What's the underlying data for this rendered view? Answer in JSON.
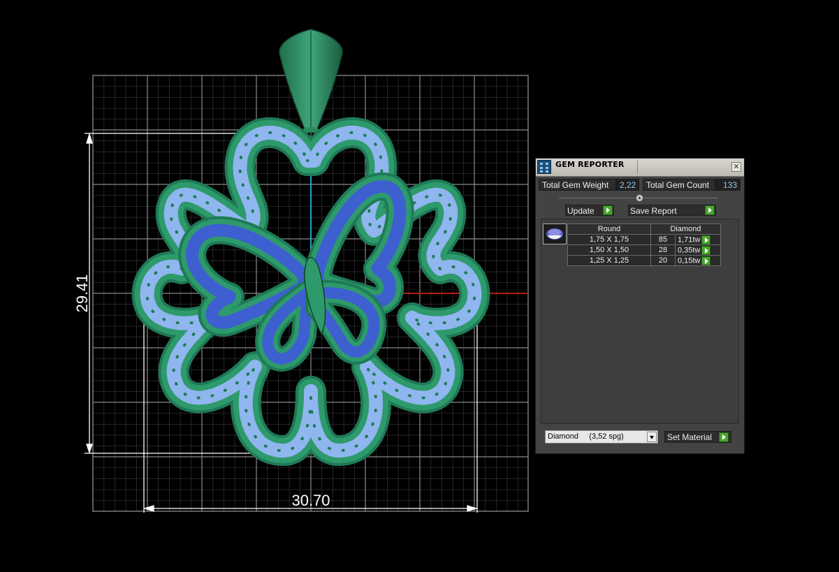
{
  "viewport": {
    "width_dimension": "30.70",
    "height_dimension": "29.41"
  },
  "gem_reporter": {
    "title": "GEM REPORTER",
    "close_label": "✕",
    "total_gem_weight_label": "Total Gem Weight",
    "total_gem_weight_value": "2,22",
    "total_gem_count_label": "Total Gem Count",
    "total_gem_count_value": "133",
    "update_label": "Update",
    "save_report_label": "Save Report",
    "table": {
      "col_shape": "Round",
      "col_material": "Diamond",
      "rows": [
        {
          "size": "1,75 X 1,75",
          "count": "85",
          "weight": "1,71tw"
        },
        {
          "size": "1,50 X 1,50",
          "count": "28",
          "weight": "0,35tw"
        },
        {
          "size": "1,25 X 1,25",
          "count": "20",
          "weight": "0,15tw"
        }
      ]
    },
    "material_select_value": "Diamond     (3,52 spg)",
    "set_material_label": "Set Material"
  },
  "colors": {
    "metal_green": "#2e8f63",
    "gem_light_blue": "#8fb6ee",
    "gem_dark_blue": "#3d5fd0",
    "accent_green": "#4aa52e"
  }
}
